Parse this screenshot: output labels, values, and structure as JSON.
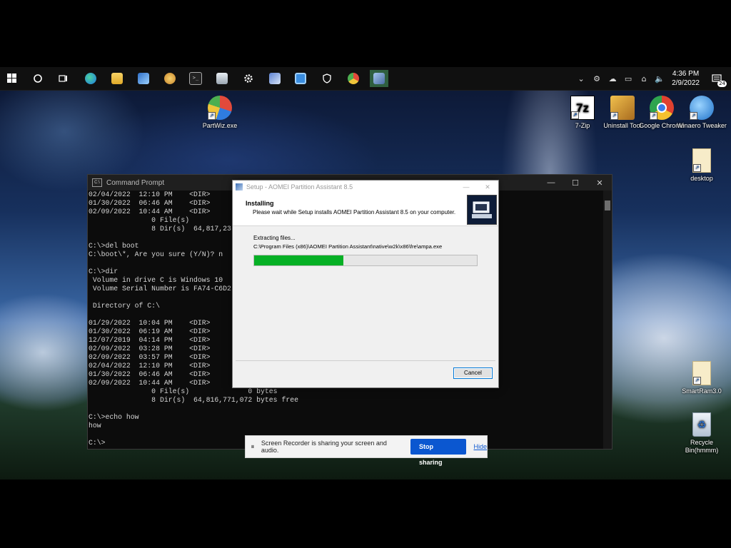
{
  "taskbar": {
    "pinned": [
      {
        "name": "windows-start",
        "color": "#ffffff"
      },
      {
        "name": "search",
        "color": "#ffffff"
      },
      {
        "name": "task-view",
        "color": "#ffffff"
      },
      {
        "name": "edge",
        "color": "#1f9ae0"
      },
      {
        "name": "file-explorer",
        "color": "#f4c542"
      },
      {
        "name": "photos",
        "color": "#3b8ee5"
      },
      {
        "name": "paint",
        "color": "#e8b24b"
      },
      {
        "name": "command-prompt",
        "color": "#333333"
      },
      {
        "name": "printer",
        "color": "#cfd6de"
      },
      {
        "name": "settings",
        "color": "#ffffff"
      },
      {
        "name": "setup-installer",
        "color": "#6b8fd6"
      },
      {
        "name": "screen-recorder",
        "color": "#4aa3f0"
      },
      {
        "name": "defender",
        "color": "#ffffff"
      },
      {
        "name": "partwiz",
        "color": "#e24a3b"
      },
      {
        "name": "aomei-active",
        "color": "#3a8b5a"
      }
    ],
    "clock": {
      "time": "4:36 PM",
      "date": "2/9/2022"
    },
    "notification_count": "24"
  },
  "desktop_icons": [
    {
      "label": "PartWiz.exe",
      "icon": "partwiz-icon",
      "color": "#e24a3b"
    },
    {
      "label": "7-Zip",
      "icon": "7zip-icon",
      "color": "#ffffff"
    },
    {
      "label": "Uninstall Tool",
      "icon": "uninstall-tool-icon",
      "color": "#e2a23b"
    },
    {
      "label": "Google Chrome",
      "icon": "chrome-icon",
      "color": "#e0412f"
    },
    {
      "label": "Winaero Tweaker",
      "icon": "winaero-icon",
      "color": "#2f8de4"
    },
    {
      "label": "desktop",
      "icon": "file-icon",
      "color": "#f5e9c8"
    },
    {
      "label": "SmartRam3.0",
      "icon": "file-icon",
      "color": "#f5e9c8"
    },
    {
      "label": "Recycle Bin(hmmm)",
      "icon": "recycle-bin-icon",
      "color": "#dfe8f2"
    }
  ],
  "cmd": {
    "title": "Command Prompt",
    "lines": [
      "02/04/2022  12:10 PM    <DIR>",
      "01/30/2022  06:46 AM    <DIR>",
      "02/09/2022  10:44 AM    <DIR>",
      "               0 File(s)",
      "               8 Dir(s)  64,817,23",
      "",
      "C:\\>del boot",
      "C:\\boot\\*, Are you sure (Y/N)? n",
      "",
      "C:\\>dir",
      " Volume in drive C is Windows 10",
      " Volume Serial Number is FA74-C6D2",
      "",
      " Directory of C:\\",
      "",
      "01/29/2022  10:04 PM    <DIR>",
      "01/30/2022  06:19 AM    <DIR>",
      "12/07/2019  04:14 PM    <DIR>",
      "02/09/2022  03:28 PM    <DIR>",
      "02/09/2022  03:57 PM    <DIR>",
      "02/04/2022  12:10 PM    <DIR>",
      "01/30/2022  06:46 AM    <DIR>",
      "02/09/2022  10:44 AM    <DIR>",
      "               0 File(s)              0 bytes",
      "               8 Dir(s)  64,816,771,072 bytes free",
      "",
      "C:\\>echo how",
      "how",
      "",
      "C:\\>"
    ]
  },
  "setup": {
    "title": "Setup - AOMEI Partition Assistant 8.5",
    "heading": "Installing",
    "subheading": "Please wait while Setup installs AOMEI Partition Assistant 8.5 on your computer.",
    "status": "Extracting files...",
    "path": "C:\\Program Files (x86)\\AOMEI Partition Assistant\\native\\w2k\\x86\\fre\\ampa.exe",
    "progress": 0.4,
    "cancel_label": "Cancel",
    "progress_color": "#06b025"
  },
  "recorder": {
    "message": "Screen Recorder is sharing your screen and audio.",
    "stop_label": "Stop sharing",
    "hide_label": "Hide"
  }
}
